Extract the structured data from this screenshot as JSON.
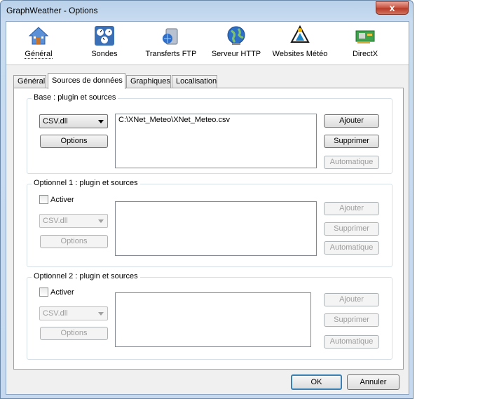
{
  "window": {
    "title": "GraphWeather - Options",
    "close_glyph": "x"
  },
  "toolbar": [
    {
      "label": "Général",
      "icon": "house-icon"
    },
    {
      "label": "Sondes",
      "icon": "gauges-icon"
    },
    {
      "label": "Transferts FTP",
      "icon": "ftp-server-icon"
    },
    {
      "label": "Serveur HTTP",
      "icon": "globe-icon"
    },
    {
      "label": "Websites Météo",
      "icon": "awekas-logo-icon"
    },
    {
      "label": "DirectX",
      "icon": "graphics-card-icon"
    }
  ],
  "tabs": [
    "Général",
    "Sources de données",
    "Graphiques",
    "Localisation"
  ],
  "active_tab": "Sources de données",
  "base": {
    "title": "Base : plugin et sources",
    "plugin": "CSV.dll",
    "options_label": "Options",
    "sources": [
      "C:\\XNet_Meteo\\XNet_Meteo.csv"
    ],
    "add_label": "Ajouter",
    "remove_label": "Supprimer",
    "auto_label": "Automatique"
  },
  "opt1": {
    "title": "Optionnel 1 : plugin et sources",
    "activate_label": "Activer",
    "plugin": "CSV.dll",
    "options_label": "Options",
    "add_label": "Ajouter",
    "remove_label": "Supprimer",
    "auto_label": "Automatique"
  },
  "opt2": {
    "title": "Optionnel 2 : plugin et sources",
    "activate_label": "Activer",
    "plugin": "CSV.dll",
    "options_label": "Options",
    "add_label": "Ajouter",
    "remove_label": "Supprimer",
    "auto_label": "Automatique"
  },
  "footer": {
    "ok_label": "OK",
    "cancel_label": "Annuler"
  }
}
